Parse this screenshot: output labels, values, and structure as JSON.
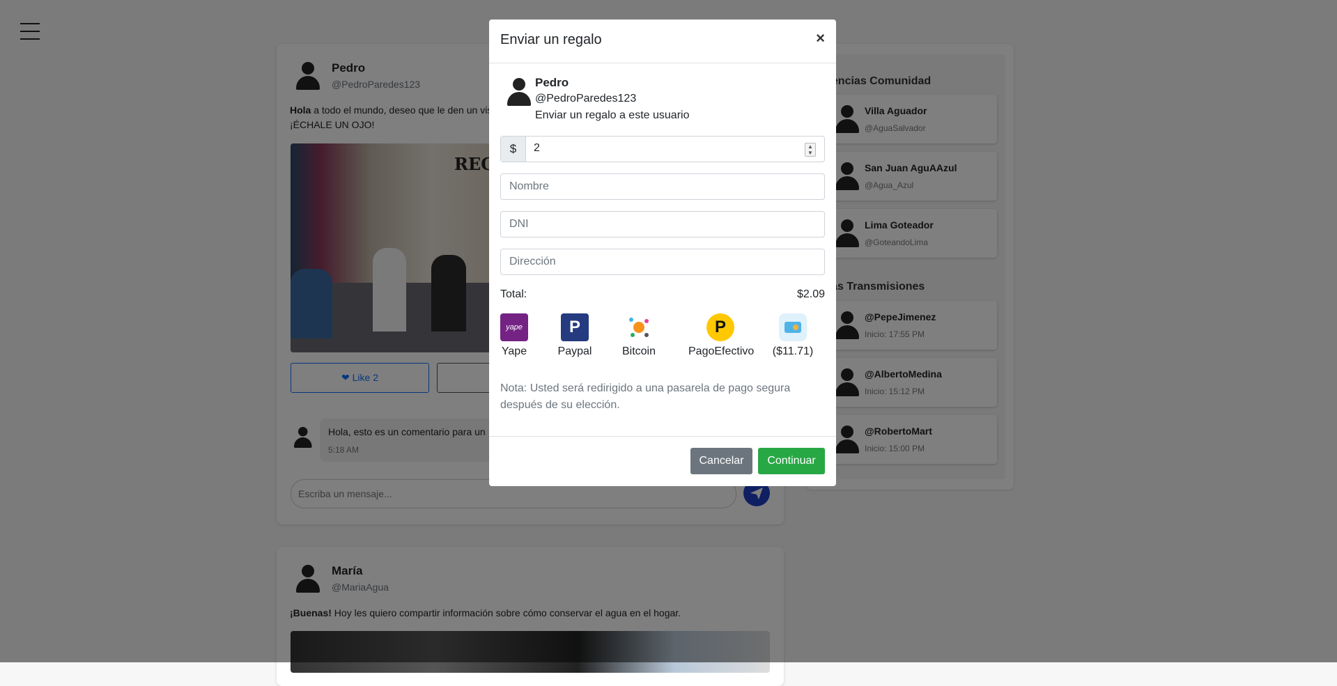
{
  "posts": [
    {
      "name": "Pedro",
      "handle": "@PedroParedes123",
      "text_bold": "Hola",
      "text_line1": " a todo el mundo, deseo que le den un vist",
      "text_line2": "¡ÉCHALE UN OJO!",
      "image_text": "REC",
      "like_label": "Like 2",
      "comment_text": "Hola, esto es un comentario para un",
      "comment_time": "5:18 AM",
      "message_placeholder": "Escriba un mensaje..."
    },
    {
      "name": "María",
      "handle": "@MariaAgua",
      "text_bold": "¡Buenas!",
      "text_line1": " Hoy les quiero compartir información sobre cómo conservar el agua en el hogar."
    }
  ],
  "sidebar": {
    "suggestions_title": "gerencias Comunidad",
    "suggestions": [
      {
        "name": "Villa Aguador",
        "handle": "@AguaSalvador"
      },
      {
        "name": "San Juan AguAAzul",
        "handle": "@Agua_Azul"
      },
      {
        "name": "Lima Goteador",
        "handle": "@GoteandoLima"
      }
    ],
    "streams_title": "timas Transmisiones",
    "streams": [
      {
        "name": "@PepeJimenez",
        "start": "Inicio: 17:55 PM"
      },
      {
        "name": "@AlbertoMedina",
        "start": "Inicio: 15:12 PM"
      },
      {
        "name": "@RobertoMart",
        "start": "Inicio: 15:00 PM"
      }
    ]
  },
  "modal": {
    "title": "Enviar un regalo",
    "close": "×",
    "user_name": "Pedro",
    "user_handle": "@PedroParedes123",
    "subtitle": "Enviar un regalo a este usuario",
    "currency_symbol": "$",
    "amount": "2",
    "name_placeholder": "Nombre",
    "dni_placeholder": "DNI",
    "address_placeholder": "Dirección",
    "total_label": "Total:",
    "total_value": "$2.09",
    "payment_methods": [
      {
        "label": "Yape",
        "icon": "yape-icon",
        "color": "#742384"
      },
      {
        "label": "Paypal",
        "icon": "paypal-icon",
        "color": "#253B80"
      },
      {
        "label": "Bitcoin",
        "icon": "bitcoin-icon",
        "color": "#f7931a"
      },
      {
        "label": "PagoEfectivo",
        "icon": "pagoefectivo-icon",
        "color": "#ffc800"
      },
      {
        "label": "($11.71)",
        "icon": "card-wallet-icon",
        "color": "#4fb3e8"
      }
    ],
    "note": "Nota: Usted será redirigido a una pasarela de pago segura después de su elección.",
    "cancel_label": "Cancelar",
    "continue_label": "Continuar"
  }
}
